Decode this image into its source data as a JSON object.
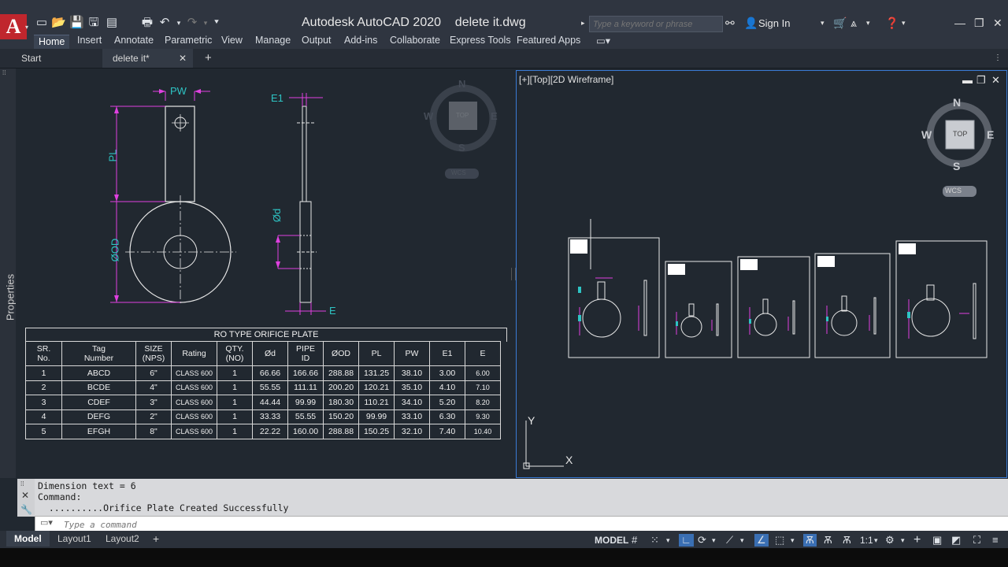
{
  "app": {
    "title": "Autodesk AutoCAD 2020",
    "file_name": "delete it.dwg",
    "logo_letter": "A",
    "search_placeholder": "Type a keyword or phrase",
    "sign_in": "Sign In"
  },
  "ribbon_tabs": [
    "Home",
    "Insert",
    "Annotate",
    "Parametric",
    "View",
    "Manage",
    "Output",
    "Add-ins",
    "Collaborate",
    "Express Tools",
    "Featured Apps"
  ],
  "file_tabs": {
    "start": "Start",
    "active": "delete it*"
  },
  "side_panel": {
    "label": "Properties"
  },
  "left_view": {
    "compass": {
      "n": "N",
      "s": "S",
      "e": "E",
      "w": "W",
      "cube": "TOP",
      "wcs": "WCS"
    },
    "dims": {
      "pw": "PW",
      "pl": "PL",
      "od": "ØOD",
      "e1": "E1",
      "d": "Ød",
      "e": "E"
    }
  },
  "table": {
    "title": "RO TYPE ORIFICE PLATE",
    "headers": [
      "SR.\nNo.",
      "Tag\nNumber",
      "SIZE\n(NPS)",
      "Rating",
      "QTY.\n(NO)",
      "Ød",
      "PIPE\nID",
      "ØOD",
      "PL",
      "PW",
      "E1",
      "E"
    ],
    "rows": [
      [
        "1",
        "ABCD",
        "6\"",
        "CLASS 600",
        "1",
        "66.66",
        "166.66",
        "288.88",
        "131.25",
        "38.10",
        "3.00",
        "6.00"
      ],
      [
        "2",
        "BCDE",
        "4\"",
        "CLASS 600",
        "1",
        "55.55",
        "111.11",
        "200.20",
        "120.21",
        "35.10",
        "4.10",
        "7.10"
      ],
      [
        "3",
        "CDEF",
        "3\"",
        "CLASS 600",
        "1",
        "44.44",
        "99.99",
        "180.30",
        "110.21",
        "34.10",
        "5.20",
        "8.20"
      ],
      [
        "4",
        "DEFG",
        "2\"",
        "CLASS 600",
        "1",
        "33.33",
        "55.55",
        "150.20",
        "99.99",
        "33.10",
        "6.30",
        "9.30"
      ],
      [
        "5",
        "EFGH",
        "8\"",
        "CLASS 600",
        "1",
        "22.22",
        "160.00",
        "288.88",
        "150.25",
        "32.10",
        "7.40",
        "10.40"
      ]
    ]
  },
  "right_view": {
    "label": "[+][Top][2D Wireframe]",
    "compass": {
      "n": "N",
      "s": "S",
      "e": "E",
      "w": "W",
      "cube": "TOP",
      "wcs": "WCS"
    },
    "ucs": {
      "x": "X",
      "y": "Y"
    }
  },
  "command": {
    "history": [
      "Dimension text = 6",
      "Command:",
      "  ..........Orifice Plate Created Successfully"
    ],
    "placeholder": "Type a command"
  },
  "status": {
    "layout_tabs": [
      "Model",
      "Layout1",
      "Layout2"
    ],
    "model_label": "MODEL",
    "scale": "1:1"
  },
  "colors": {
    "magenta": "#e040e0",
    "cyan": "#2ec4c4",
    "viewport_border": "#3a7bd5",
    "logo_red": "#c0262d"
  }
}
